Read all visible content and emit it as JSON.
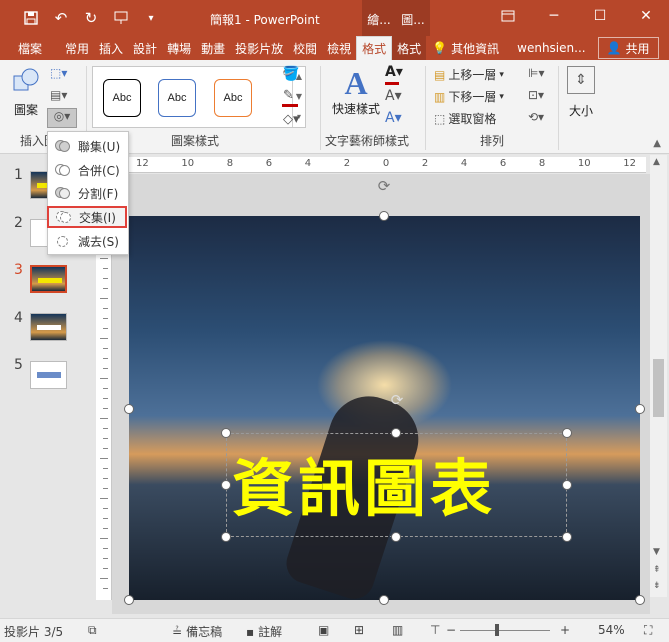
{
  "title_bar": {
    "doc_title": "簡報1 - PowerPoint",
    "context_groups": [
      "繪...",
      "圖..."
    ],
    "qat_icons": [
      "save-icon",
      "undo-icon",
      "redo-icon",
      "present-icon",
      "customize-icon"
    ],
    "window_controls": [
      "ribbon-display-icon",
      "minimize-icon",
      "maximize-icon",
      "close-icon"
    ]
  },
  "tabs": {
    "items": [
      "檔案",
      "常用",
      "插入",
      "設計",
      "轉場",
      "動畫",
      "投影片放",
      "校閱",
      "檢視",
      "格式",
      "格式"
    ],
    "active": "格式",
    "tell_me": "其他資訊",
    "user": "wenhsien...",
    "share": "共用"
  },
  "ribbon": {
    "insert_shapes": {
      "shapes_label": "圖案",
      "group_label": "插入圖"
    },
    "shape_styles": {
      "swatch_label": "Abc",
      "group_label": "圖案樣式"
    },
    "wordart": {
      "quick_styles": "快速樣式",
      "group_label": "文字藝術師樣式"
    },
    "arrange": {
      "bring_forward": "上移一層",
      "send_backward": "下移一層",
      "selection_pane": "選取窗格",
      "group_label": "排列"
    },
    "size": {
      "label": "大小"
    },
    "colors": {
      "outline_1": "#000000",
      "outline_2": "#4472c4",
      "outline_3": "#ed7d31",
      "font_color": "#c00000",
      "fill_color": "#c00000"
    }
  },
  "merge_menu": {
    "items": [
      {
        "label": "聯集(U)"
      },
      {
        "label": "合併(C)"
      },
      {
        "label": "分割(F)"
      },
      {
        "label": "交集(I)",
        "highlighted": true
      },
      {
        "label": "減去(S)"
      }
    ]
  },
  "thumbnails": {
    "items": [
      {
        "num": "1"
      },
      {
        "num": "2"
      },
      {
        "num": "3",
        "selected": true
      },
      {
        "num": "4"
      },
      {
        "num": "5"
      }
    ]
  },
  "slide": {
    "title_text": "資訊圖表",
    "text_color": "#ffff00"
  },
  "ruler": {
    "labels": [
      "12",
      "10",
      "8",
      "6",
      "4",
      "2",
      "0",
      "2",
      "4",
      "6",
      "8",
      "10",
      "12"
    ]
  },
  "status_bar": {
    "slide_info": "投影片 3/5",
    "notes": "備忘稿",
    "comments": "註解",
    "zoom": "54%"
  }
}
